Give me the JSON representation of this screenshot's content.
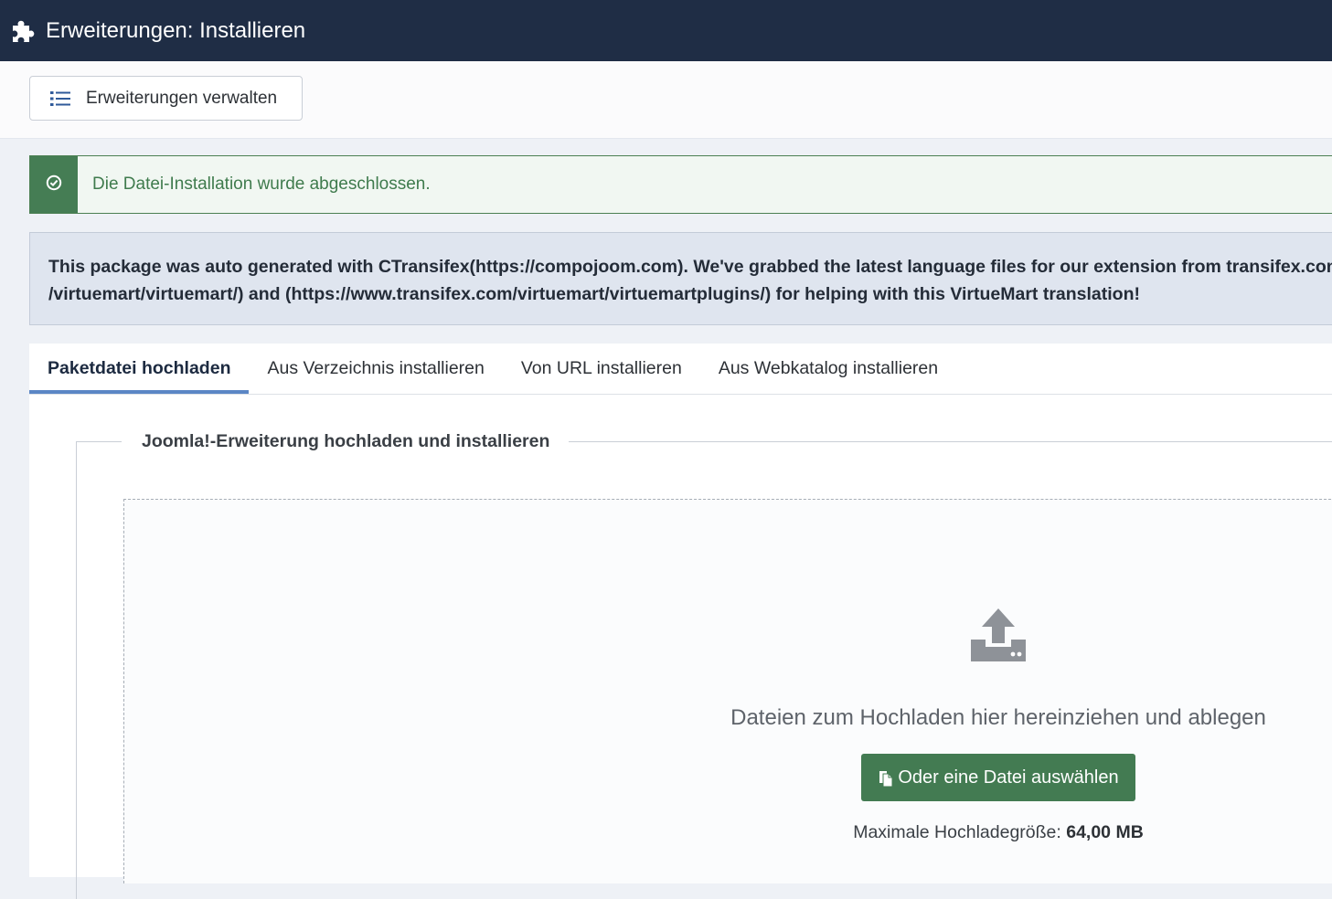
{
  "header": {
    "title": "Erweiterungen: Installieren",
    "icon": "puzzle-icon"
  },
  "toolbar": {
    "manage_label": "Erweiterungen verwalten",
    "manage_icon": "list-icon"
  },
  "alert_success": {
    "message": "Die Datei-Installation wurde abgeschlossen.",
    "icon": "check-circle-icon",
    "color": "#457d54"
  },
  "alert_info": {
    "line1": "This package was auto generated with CTransifex(https://compojoom.com). We've grabbed the latest language files for our extension from transifex.com. Sp",
    "line2": "/virtuemart/virtuemart/) and (https://www.transifex.com/virtuemart/virtuemartplugins/) for helping with this VirtueMart translation!"
  },
  "tabs": [
    {
      "label": "Paketdatei hochladen",
      "active": true
    },
    {
      "label": "Aus Verzeichnis installieren",
      "active": false
    },
    {
      "label": "Von URL installieren",
      "active": false
    },
    {
      "label": "Aus Webkatalog installieren",
      "active": false
    }
  ],
  "upload": {
    "legend": "Joomla!-Erweiterung hochladen und installieren",
    "drop_text": "Dateien zum Hochladen hier hereinziehen und ablegen",
    "choose_label": "Oder eine Datei auswählen",
    "max_label": "Maximale Hochladegröße:",
    "max_value": "64,00 MB",
    "icon": "upload-icon",
    "button_color": "#437b52"
  }
}
